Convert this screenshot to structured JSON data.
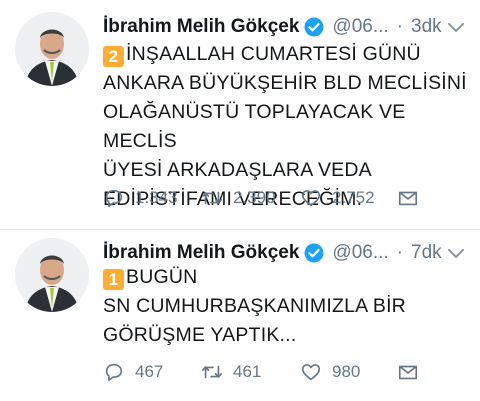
{
  "colors": {
    "text": "#14171a",
    "secondary": "#657786",
    "verified": "#1da1f2",
    "badge": "#ffac33",
    "divider": "#e1e8ed"
  },
  "tweets": [
    {
      "author": "İbrahim Melih Gökçek",
      "handle": "@06...",
      "separator": "·",
      "time": "3dk",
      "badge": "2",
      "lines": [
        "İNŞAALLAH CUMARTESİ GÜNÜ",
        "ANKARA BÜYÜKŞEHİR BLD MECLİSİNİ",
        "OLAĞANÜSTÜ TOPLAYACAK VE MECLİS",
        "ÜYESİ ARKADAŞLARA VEDA",
        "EDİPİSTİFAMI VERECEĞİM."
      ],
      "replies": "1.343",
      "retweets": "2.390",
      "likes": "2.752",
      "icons": [
        "verified-icon",
        "chevron-down-icon",
        "reply-icon",
        "retweet-icon",
        "like-icon",
        "share-icon"
      ]
    },
    {
      "author": "İbrahim Melih Gökçek",
      "handle": "@06...",
      "separator": "·",
      "time": "7dk",
      "badge": "1",
      "lines": [
        "BUGÜN",
        "SN CUMHURBAŞKANIMIZLA BİR",
        "GÖRÜŞME YAPTIK..."
      ],
      "replies": "467",
      "retweets": "461",
      "likes": "980",
      "icons": [
        "verified-icon",
        "chevron-down-icon",
        "reply-icon",
        "retweet-icon",
        "like-icon",
        "share-icon"
      ]
    }
  ]
}
